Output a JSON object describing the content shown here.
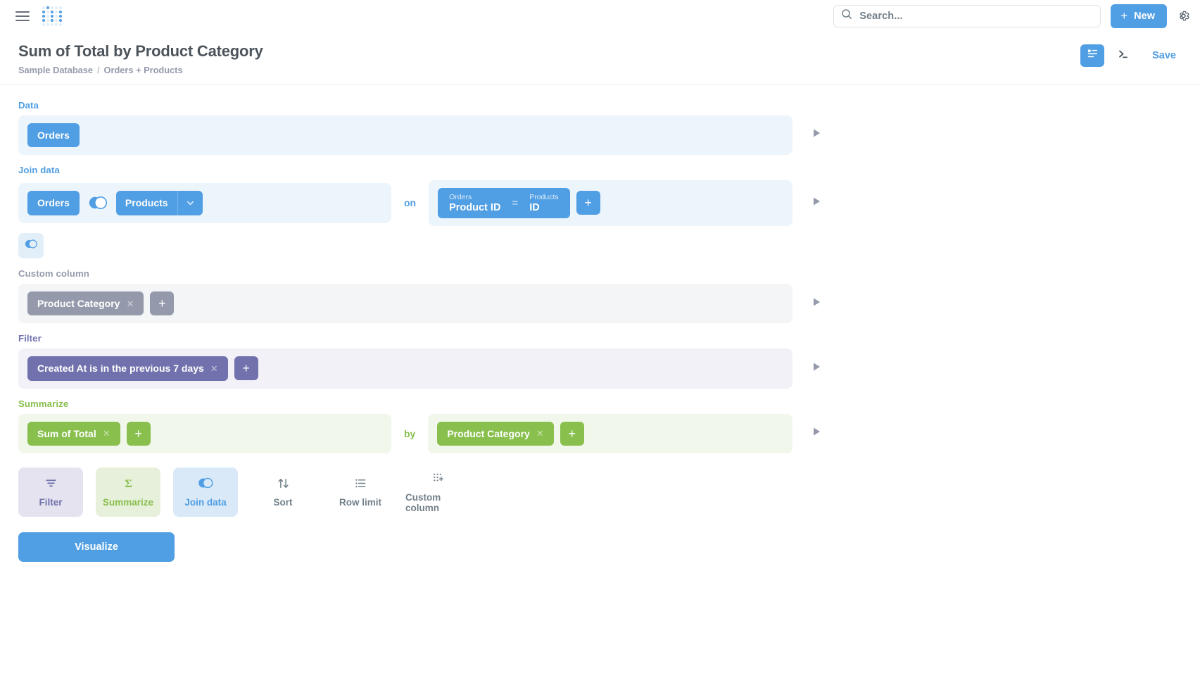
{
  "nav": {
    "menu_icon": "hamburger-icon",
    "logo_icon": "metabase-logo-icon",
    "search": {
      "placeholder": "Search...",
      "value": "",
      "icon": "search-icon"
    },
    "new_button": {
      "label": "New",
      "icon": "plus-icon"
    },
    "settings_icon": "gear-icon"
  },
  "header": {
    "title": "Sum of Total by Product Category",
    "breadcrumb": {
      "database": "Sample Database",
      "separator": "/",
      "table": "Orders + Products"
    },
    "notebook_toggle_icon": "notebook-editor-icon",
    "native_query_icon": "sql-console-icon",
    "save_label": "Save"
  },
  "steps": {
    "data": {
      "label": "Data",
      "table": "Orders",
      "expand_icon": "triangle-right-icon"
    },
    "join": {
      "label": "Join data",
      "left_table": "Orders",
      "join_type_icon": "left-join-venn-icon",
      "right_table": "Products",
      "right_caret_icon": "chevron-down-icon",
      "on_word": "on",
      "condition": {
        "lhs_table": "Orders",
        "lhs_field": "Product ID",
        "operator": "=",
        "rhs_table": "Products",
        "rhs_field": "ID"
      },
      "add_condition_label": "+",
      "add_join_icon": "left-join-venn-icon",
      "expand_icon": "triangle-right-icon"
    },
    "custom_column": {
      "label": "Custom column",
      "columns": [
        {
          "name": "Product Category",
          "remove_icon": "close-icon"
        }
      ],
      "add_label": "+",
      "expand_icon": "triangle-right-icon"
    },
    "filter": {
      "label": "Filter",
      "filters": [
        {
          "name": "Created At is in the previous 7 days",
          "remove_icon": "close-icon"
        }
      ],
      "add_label": "+",
      "expand_icon": "triangle-right-icon"
    },
    "summarize": {
      "label": "Summarize",
      "aggregations": [
        {
          "name": "Sum of Total",
          "remove_icon": "close-icon"
        }
      ],
      "add_aggregation_label": "+",
      "by_word": "by",
      "breakouts": [
        {
          "name": "Product Category",
          "remove_icon": "close-icon"
        }
      ],
      "add_breakout_label": "+",
      "expand_icon": "triangle-right-icon"
    }
  },
  "actions": [
    {
      "label": "Filter",
      "icon": "filter-icon",
      "style": "filter",
      "active": true
    },
    {
      "label": "Summarize",
      "icon": "sigma-icon",
      "style": "summarize",
      "active": true
    },
    {
      "label": "Join data",
      "icon": "left-join-venn-icon",
      "style": "join",
      "active": true
    },
    {
      "label": "Sort",
      "icon": "sort-arrows-icon",
      "style": "plain",
      "active": false
    },
    {
      "label": "Row limit",
      "icon": "list-icon",
      "style": "plain",
      "active": false
    },
    {
      "label": "Custom column",
      "icon": "custom-column-icon",
      "style": "plain",
      "active": false
    }
  ],
  "visualize_button": {
    "label": "Visualize"
  },
  "colors": {
    "brand_blue": "#509ee3",
    "filter_purple": "#7172ad",
    "summarize_green": "#88bf4d",
    "custom_grey": "#949aab",
    "text_dark": "#4c545b",
    "text_medium": "#73808a"
  }
}
